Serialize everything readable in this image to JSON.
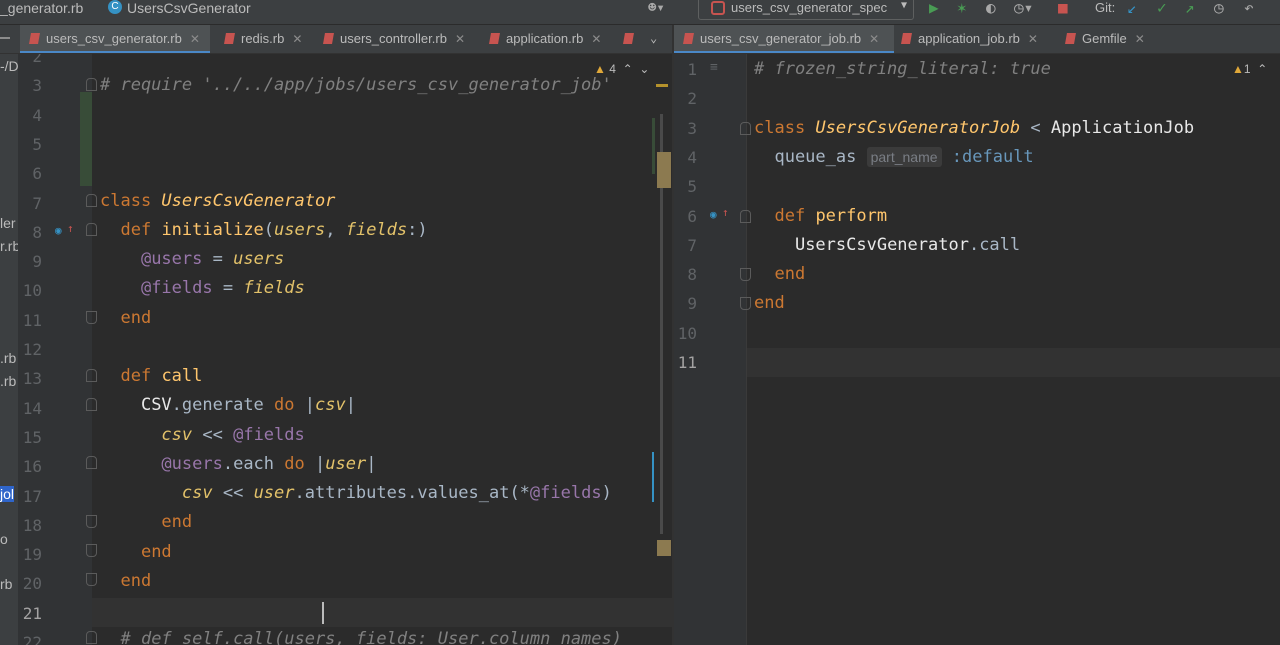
{
  "topbar": {
    "path_fragment": "_generator.rb",
    "class_badge": "C",
    "class_name": "UsersCsvGenerator",
    "run_config": "users_csv_generator_spec",
    "git_label": "Git:"
  },
  "left_tabs": [
    {
      "label": "users_csv_generator.rb",
      "active": true
    },
    {
      "label": "redis.rb",
      "active": false
    },
    {
      "label": "users_controller.rb",
      "active": false
    },
    {
      "label": "application.rb",
      "active": false
    }
  ],
  "right_tabs": [
    {
      "label": "users_csv_generator_job.rb",
      "active": true
    },
    {
      "label": "application_job.rb",
      "active": false
    },
    {
      "label": "Gemfile",
      "active": false
    }
  ],
  "left_strip": [
    "-/D",
    "ler",
    "r.rb",
    ".rb",
    ".rb",
    "jol",
    "o",
    "rb"
  ],
  "left_editor": {
    "warning_count": "4",
    "line_numbers": [
      "2",
      "3",
      "4",
      "5",
      "6",
      "7",
      "8",
      "9",
      "10",
      "11",
      "12",
      "13",
      "14",
      "15",
      "16",
      "17",
      "18",
      "19",
      "20",
      "21",
      "22"
    ]
  },
  "right_editor": {
    "warning_count": "1",
    "line_numbers": [
      "1",
      "2",
      "3",
      "4",
      "5",
      "6",
      "7",
      "8",
      "9",
      "10",
      "11"
    ],
    "param_hint": "part_name"
  }
}
